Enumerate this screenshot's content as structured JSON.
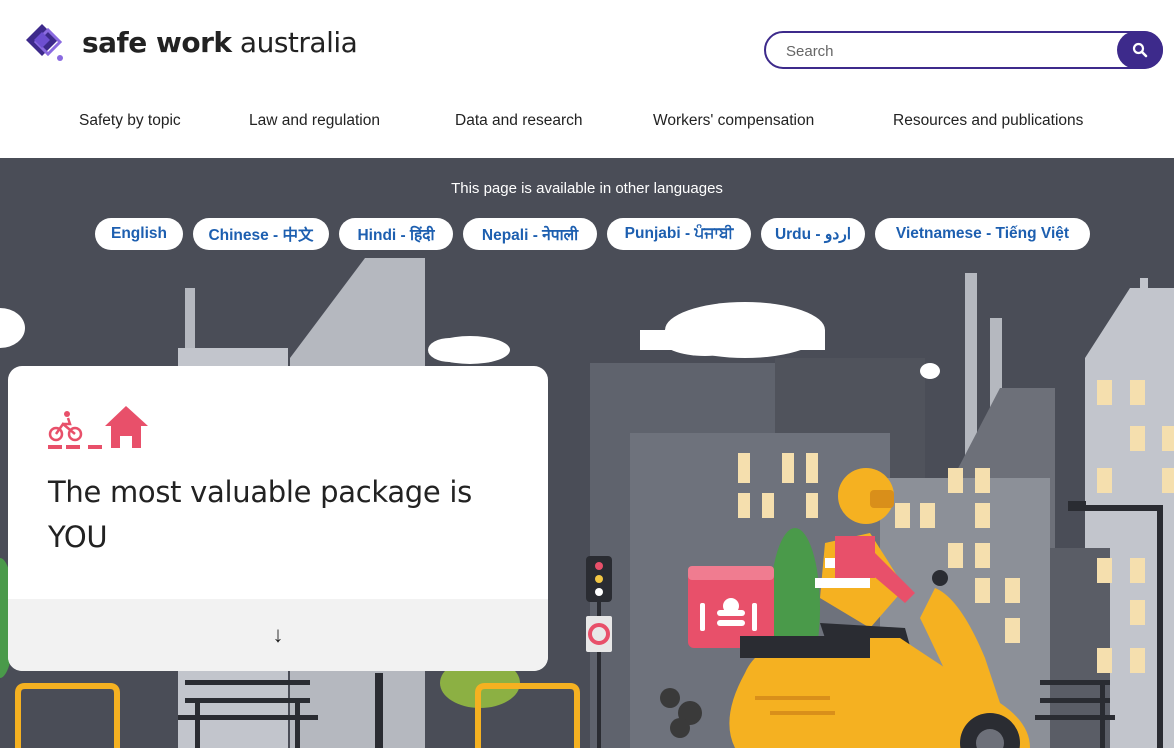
{
  "header": {
    "logo_text_bold": "safe work",
    "logo_text_light": "australia",
    "search_placeholder": "Search"
  },
  "nav": {
    "items": [
      "Safety by topic",
      "Law and regulation",
      "Data and research",
      "Workers' compensation",
      "Resources and publications"
    ]
  },
  "languages": {
    "title": "This page is available in other languages",
    "options": [
      "English",
      "Chinese - 中文",
      "Hindi - हिंदी",
      "Nepali - नेपाली",
      "Punjabi - ਪੰਜਾਬੀ",
      "Urdu - اردو",
      "Vietnamese - Tiếng Việt"
    ]
  },
  "hero_card": {
    "title": "The most valuable package is YOU",
    "scroll_arrow": "↓"
  },
  "colors": {
    "brand_purple": "#3d2a8b",
    "link_blue": "#1d5fb0",
    "accent_pink": "#e8506a",
    "hero_bg": "#4a4d57"
  }
}
